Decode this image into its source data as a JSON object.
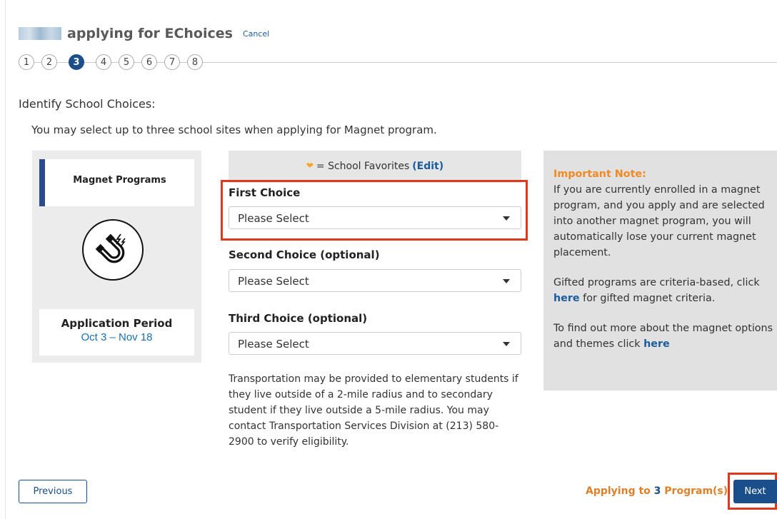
{
  "header": {
    "title": "applying for EChoices",
    "cancel_label": "Cancel"
  },
  "stepper": {
    "steps": [
      "1",
      "2",
      "3",
      "4",
      "5",
      "6",
      "7",
      "8"
    ],
    "active_step": 3
  },
  "section": {
    "title": "Identify School Choices:",
    "intro": "You may select up to three school sites when applying for Magnet program."
  },
  "program_card": {
    "label": "Magnet Programs",
    "icon": "magnet-icon",
    "period_title": "Application Period",
    "period_dates": "Oct 3 – Nov 18"
  },
  "favorites": {
    "icon": "heart-icon",
    "text": "= School Favorites",
    "edit_label": "(Edit)"
  },
  "choices": [
    {
      "label": "First Choice",
      "value": "Please Select"
    },
    {
      "label": "Second Choice (optional)",
      "value": "Please Select"
    },
    {
      "label": "Third Choice (optional)",
      "value": "Please Select"
    }
  ],
  "transport_text": "Transportation may be provided to elementary students if they live outside of a 2-mile radius and to secondary student if they live outside a 5-mile radius. You may contact Transportation Services Division at (213) 580-2900 to verify eligibility.",
  "note": {
    "title": "Important Note:",
    "p1": "If you are currently enrolled in a magnet program, and you apply and are selected into another magnet program, you will automatically lose your current magnet placement.",
    "p2_before": "Gifted programs are criteria-based, click",
    "p2_link": "here",
    "p2_after": "for gifted magnet criteria.",
    "p3_before": "To find out more about the magnet options and themes click",
    "p3_link": "here"
  },
  "footer": {
    "previous_label": "Previous",
    "applying_prefix": "Applying to",
    "applying_count": "3",
    "applying_suffix": "Program(s)",
    "next_label": "Next"
  },
  "colors": {
    "primary": "#1a4f8b",
    "accent_orange": "#f08a24",
    "highlight_red": "#e03a1e",
    "link_blue": "#1a5d9e"
  }
}
